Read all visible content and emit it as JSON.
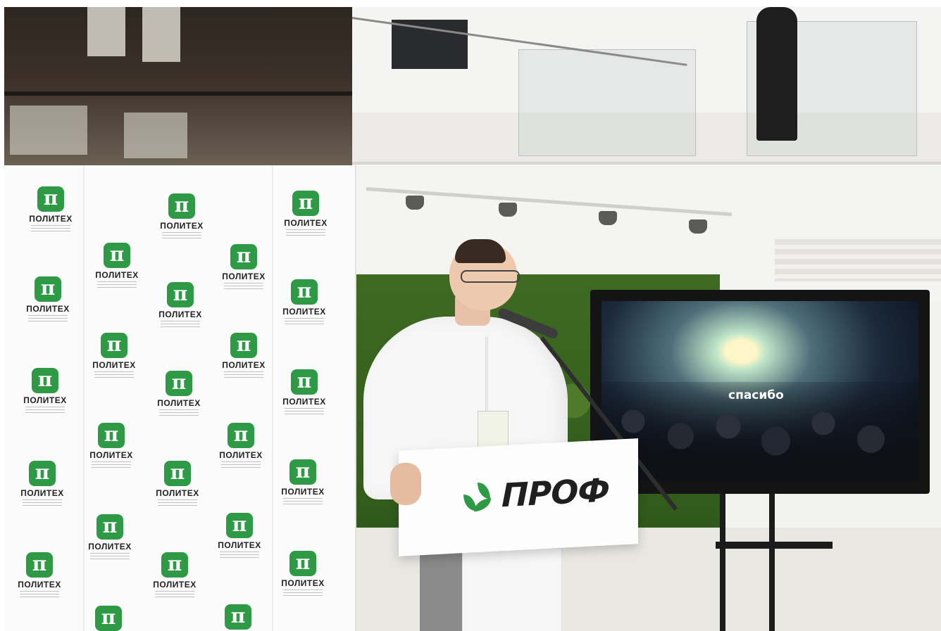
{
  "photo": {
    "description_tags": [
      "press-wall",
      "speaker",
      "podium",
      "display-screen",
      "atrium"
    ]
  },
  "press_wall": {
    "brand_word": "ПОЛИТЕХ",
    "logo_glyph": "π",
    "brand_color": "#2e9a45"
  },
  "podium": {
    "brand_word": "ПРОФ",
    "brand_color": "#2e9a45"
  },
  "screen": {
    "text": "спасибо"
  }
}
